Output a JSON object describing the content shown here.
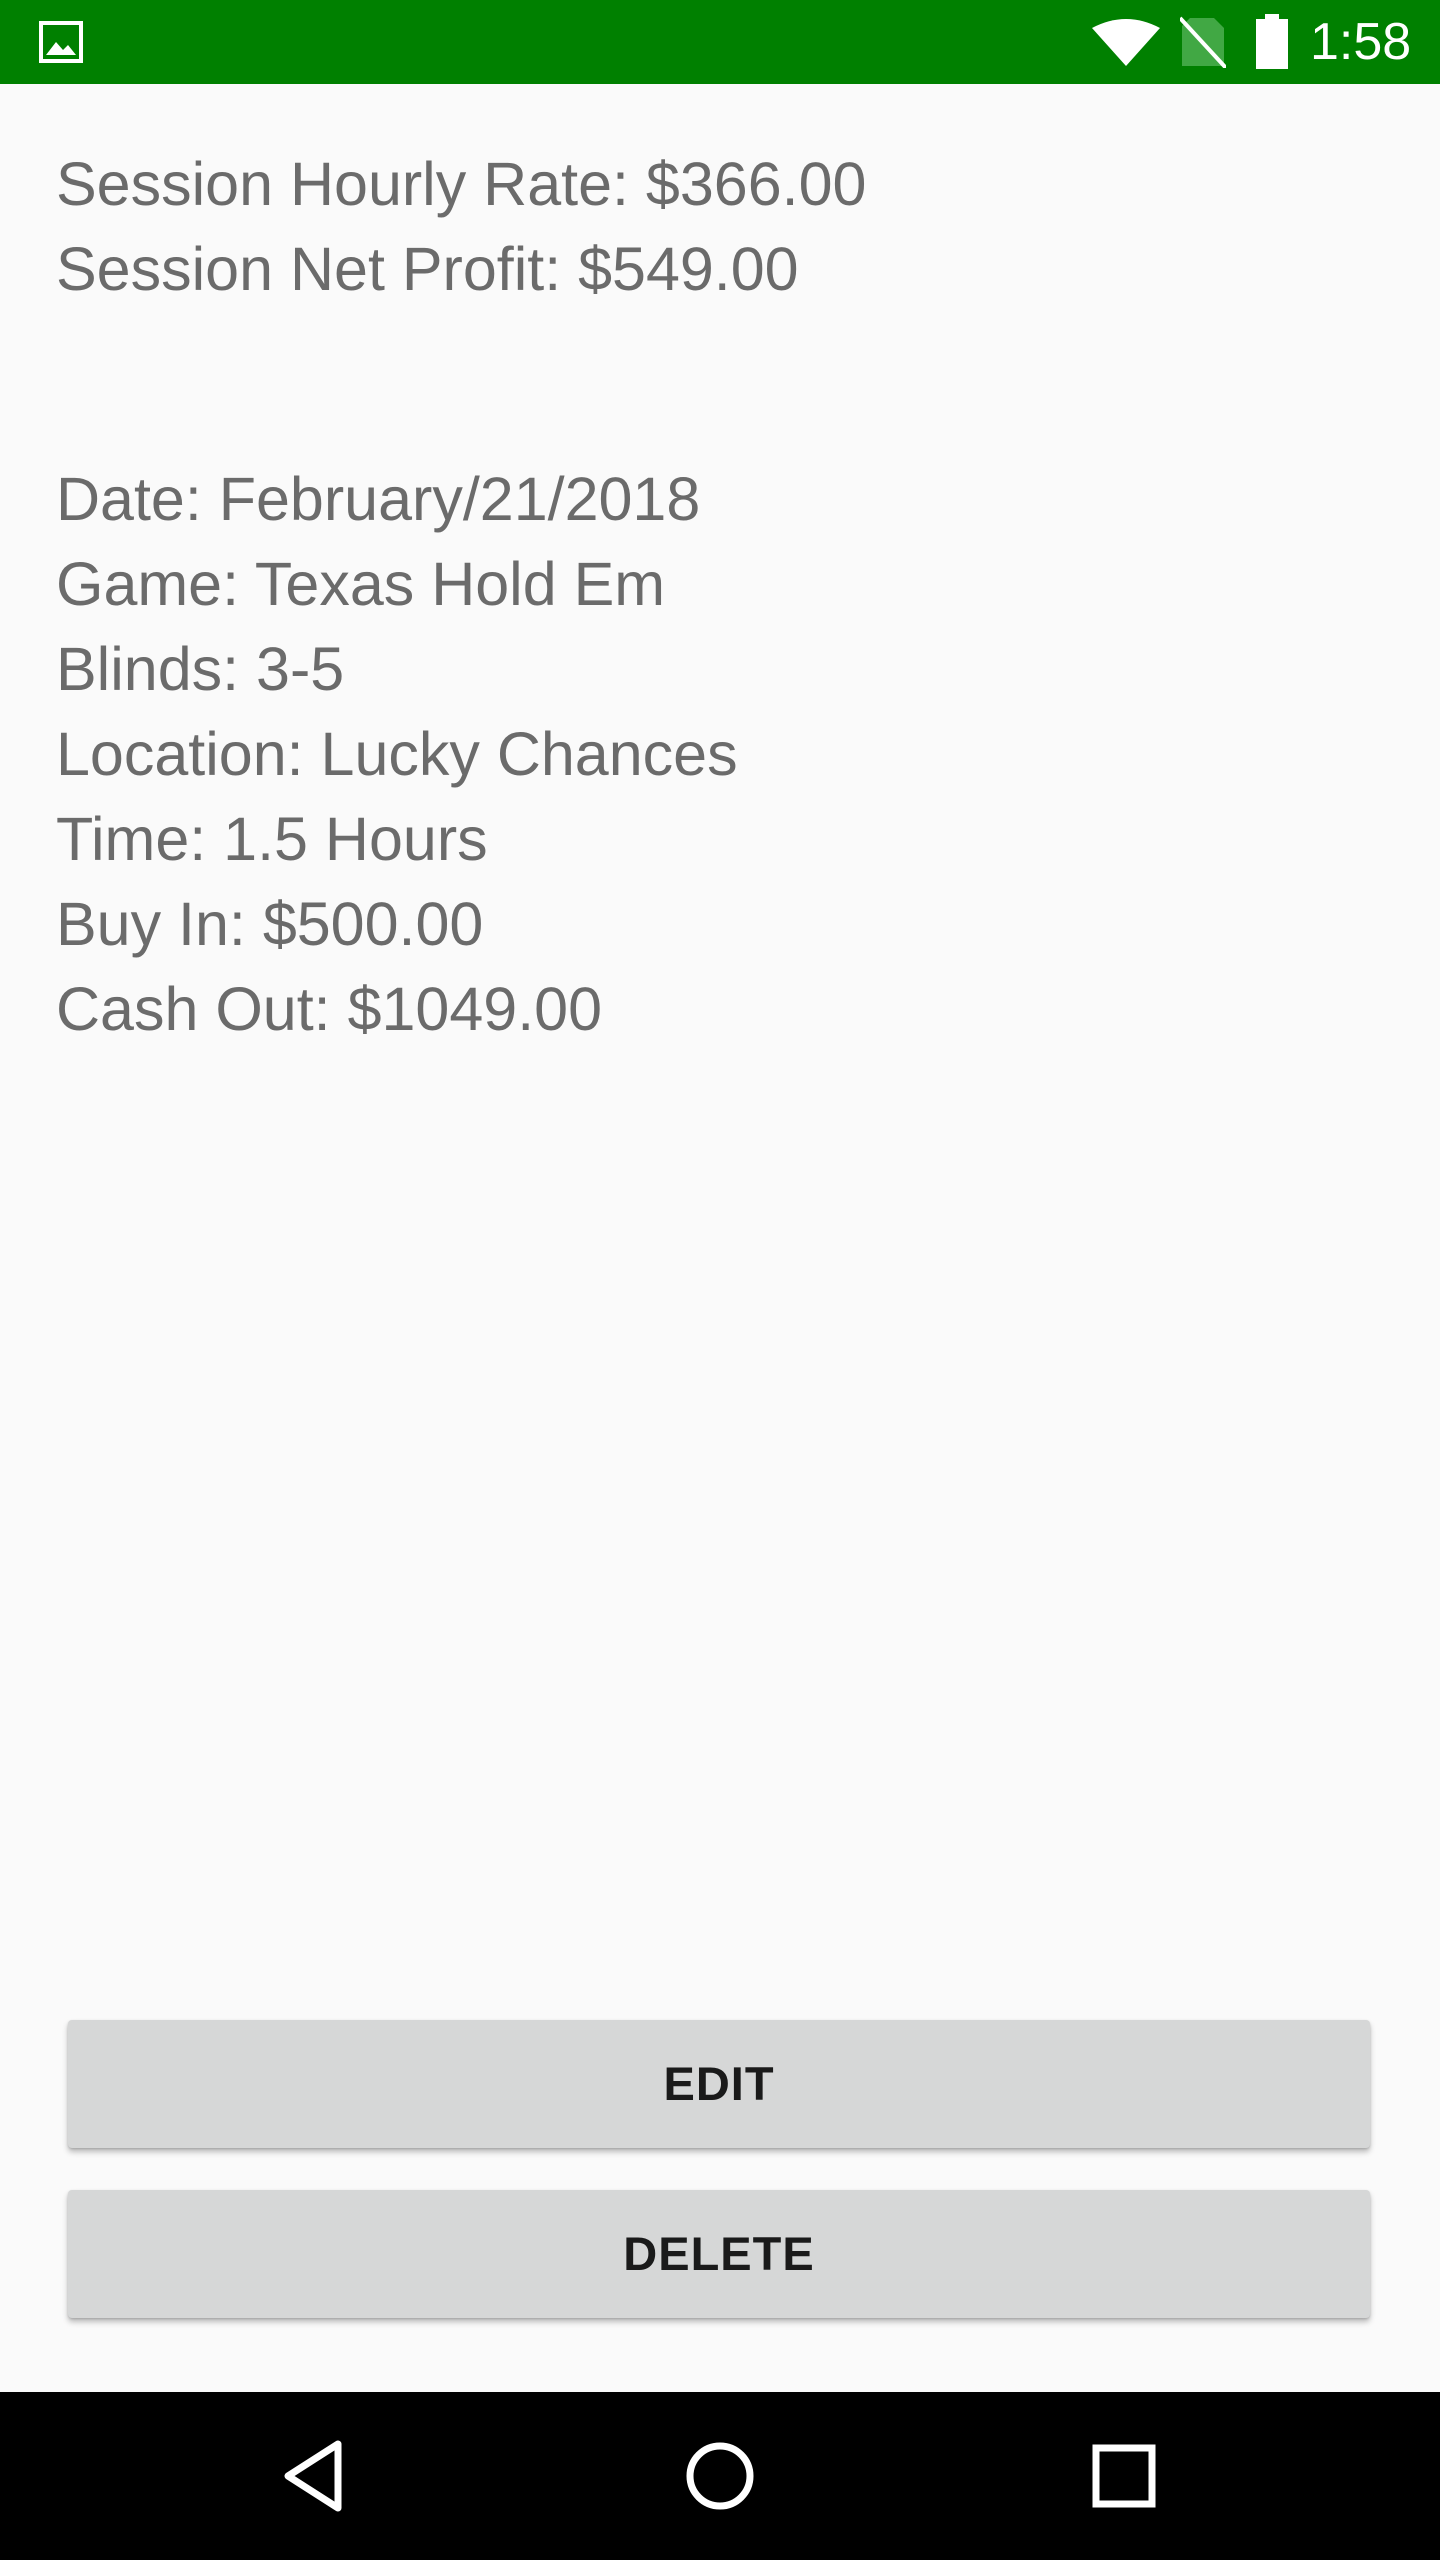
{
  "status_bar": {
    "time": "1:58",
    "icons": [
      "gallery-icon",
      "wifi-icon",
      "no-sim-icon",
      "battery-icon"
    ],
    "background_color": "#008000"
  },
  "session": {
    "hourly_rate": "Session Hourly Rate: $366.00",
    "net_profit": "Session Net Profit: $549.00"
  },
  "details": {
    "date": "Date: February/21/2018",
    "game": "Game: Texas Hold Em",
    "blinds": "Blinds: 3-5",
    "location": "Location: Lucky Chances",
    "time": "Time: 1.5 Hours",
    "buy_in": "Buy In: $500.00",
    "cash_out": "Cash Out: $1049.00"
  },
  "actions": {
    "edit_label": "EDIT",
    "delete_label": "DELETE"
  },
  "nav_bar": {
    "icons": [
      "back-icon",
      "home-icon",
      "recents-icon"
    ]
  }
}
